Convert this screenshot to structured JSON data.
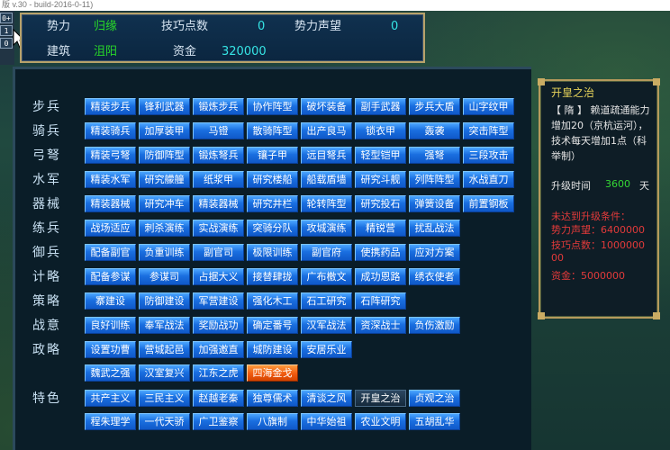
{
  "window": {
    "title": "版 v.30 - build-2016-0-11)"
  },
  "mini_tags": [
    "0+",
    "1",
    "0"
  ],
  "info": {
    "power_label": "势力",
    "power_value": "归缘",
    "skill_label": "技巧点数",
    "skill_value": "0",
    "fame_label": "势力声望",
    "fame_value": "0",
    "build_label": "建筑",
    "build_value": "沮阳",
    "fund_label": "资金",
    "fund_value": "320000"
  },
  "rows": [
    {
      "label": "步兵",
      "buttons": [
        "精装步兵",
        "锋利武器",
        "锻炼步兵",
        "协作阵型",
        "破坏装备",
        "副手武器",
        "步兵大盾",
        "山字纹甲"
      ]
    },
    {
      "label": "骑兵",
      "buttons": [
        "精装骑兵",
        "加厚装甲",
        "马镫",
        "散骑阵型",
        "出产良马",
        "锁衣甲",
        "轰袭",
        "突击阵型"
      ]
    },
    {
      "label": "弓弩",
      "buttons": [
        "精装弓弩",
        "防御阵型",
        "锻炼弩兵",
        "镶子甲",
        "远目弩兵",
        "轻型铠甲",
        "强弩",
        "三段攻击"
      ]
    },
    {
      "label": "水军",
      "buttons": [
        "精装水军",
        "研究艨艟",
        "纸浆甲",
        "研究楼船",
        "船载盾墙",
        "研究斗舰",
        "列阵阵型",
        "水战直刀"
      ]
    },
    {
      "label": "器械",
      "buttons": [
        "精装器械",
        "研究冲车",
        "精装器械",
        "研究井栏",
        "轮转阵型",
        "研究投石",
        "弹簧设备",
        "前置钢板"
      ]
    },
    {
      "label": "练兵",
      "buttons": [
        "战场适应",
        "刺杀演练",
        "实战演练",
        "突骑分队",
        "攻城演练",
        "精锐营",
        "扰乱战法"
      ]
    },
    {
      "label": "御兵",
      "buttons": [
        "配备副官",
        "负重训练",
        "副官司",
        "极限训练",
        "副官府",
        "使携药品",
        "应对方案"
      ]
    },
    {
      "label": "计略",
      "buttons": [
        "配备参谋",
        "参谋司",
        "占据大义",
        "接替肆拢",
        "广布檄文",
        "成功恩路",
        "绣衣使者"
      ]
    },
    {
      "label": "策略",
      "buttons": [
        "寨建设",
        "防御建设",
        "军营建设",
        "强化木工",
        "石工研究",
        "石阵研究"
      ]
    },
    {
      "label": "战意",
      "buttons": [
        "良好训练",
        "奉军战法",
        "奖励战功",
        "确定番号",
        "汉军战法",
        "资深战士",
        "负伤激励"
      ]
    },
    {
      "label": "政略",
      "buttons": [
        "设置功曹",
        "营城起邑",
        "加强邀直",
        "城防建设",
        "安居乐业"
      ]
    },
    {
      "label": "",
      "buttons": [
        "魏武之强",
        "汉室复兴",
        "江东之虎",
        "四海金戈"
      ]
    },
    {
      "label": "特色",
      "buttons": [
        "共产主义",
        "三民主义",
        "赵越老秦",
        "独尊儒术",
        "清谈之风",
        "开皇之治",
        "贞观之治"
      ]
    },
    {
      "label": "",
      "buttons": [
        "程朱理学",
        "一代天骄",
        "广卫鉴察",
        "八旗制",
        "中华始祖",
        "农业文明",
        "五胡乱华"
      ]
    }
  ],
  "highlight_button": "四海金戈",
  "selected_button": "开皇之治",
  "detail": {
    "title": "开皇之治",
    "description": "【 隋 】 赖道疏通能力增加20（京杭运河），技术每天增加1点（科举制）",
    "time_label": "升级时间",
    "time_value": "3600",
    "time_unit": "天",
    "req_title": "未达到升级条件：",
    "requirements": [
      "势力声望：6400000",
      "技巧点数：1000000 00",
      "资金：5000000"
    ]
  },
  "colors": {
    "button_blue": "#1a6fe0",
    "button_orange": "#f05a10",
    "frame_gold": "#b8a26a"
  }
}
